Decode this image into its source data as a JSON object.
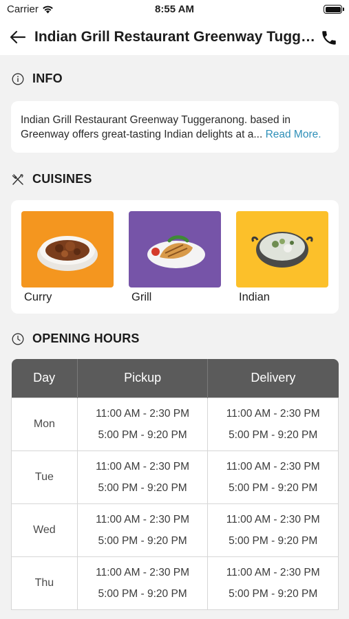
{
  "status_bar": {
    "carrier": "Carrier",
    "time": "8:55 AM"
  },
  "header": {
    "title": "Indian Grill Restaurant Greenway Tugger..."
  },
  "info": {
    "heading": "INFO",
    "text": "Indian Grill Restaurant Greenway Tuggeranong. based in Greenway offers great-tasting Indian delights at a...",
    "read_more": "Read More."
  },
  "cuisines": {
    "heading": "CUISINES",
    "items": [
      {
        "name": "Curry",
        "bg": "#f4961f"
      },
      {
        "name": "Grill",
        "bg": "#7654a8"
      },
      {
        "name": "Indian",
        "bg": "#fcc02a"
      }
    ]
  },
  "hours": {
    "heading": "OPENING HOURS",
    "columns": [
      "Day",
      "Pickup",
      "Delivery"
    ],
    "rows": [
      {
        "day": "Mon",
        "pickup": [
          "11:00 AM - 2:30 PM",
          "5:00 PM - 9:20 PM"
        ],
        "delivery": [
          "11:00 AM - 2:30 PM",
          "5:00 PM - 9:20 PM"
        ]
      },
      {
        "day": "Tue",
        "pickup": [
          "11:00 AM - 2:30 PM",
          "5:00 PM - 9:20 PM"
        ],
        "delivery": [
          "11:00 AM - 2:30 PM",
          "5:00 PM - 9:20 PM"
        ]
      },
      {
        "day": "Wed",
        "pickup": [
          "11:00 AM - 2:30 PM",
          "5:00 PM - 9:20 PM"
        ],
        "delivery": [
          "11:00 AM - 2:30 PM",
          "5:00 PM - 9:20 PM"
        ]
      },
      {
        "day": "Thu",
        "pickup": [
          "11:00 AM - 2:30 PM",
          "5:00 PM - 9:20 PM"
        ],
        "delivery": [
          "11:00 AM - 2:30 PM",
          "5:00 PM - 9:20 PM"
        ]
      }
    ]
  },
  "colors": {
    "accent_link": "#2e8fb8",
    "table_header": "#5b5b5b",
    "page_bg": "#f2f2f2"
  }
}
